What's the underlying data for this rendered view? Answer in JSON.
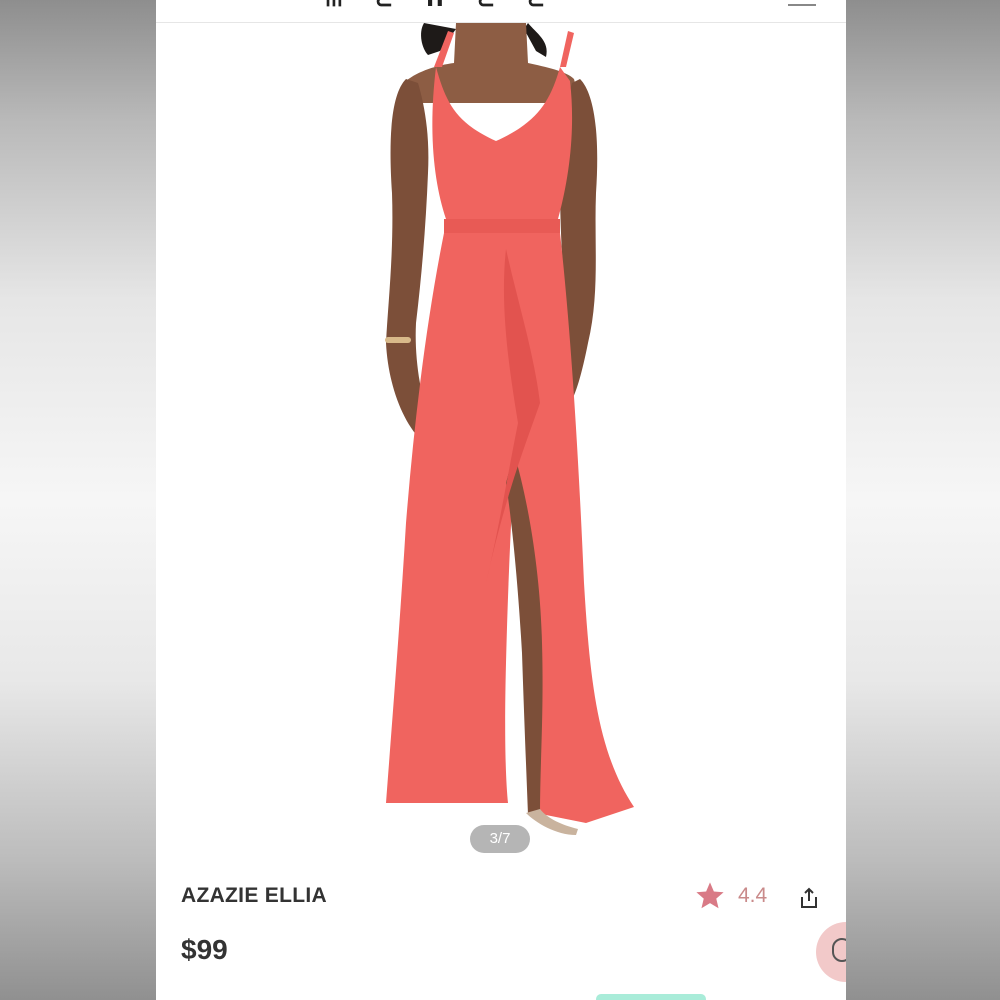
{
  "header": {
    "brand_text": "ᗰ ᗴ ᑎ ᗴ ᗴ",
    "menu_icon": "hamburger-menu-icon"
  },
  "gallery": {
    "counter": "3/7",
    "dress_color": "#f0645f"
  },
  "product": {
    "title": "AZAZIE ELLIA",
    "price": "$99",
    "rating": "4.4",
    "star_color": "#d97a86",
    "share_icon": "share-icon",
    "chat_icon": "chat-icon"
  }
}
